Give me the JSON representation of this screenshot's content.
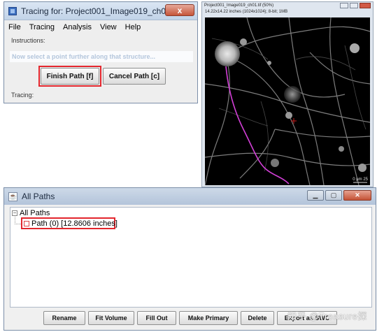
{
  "tracing_window": {
    "title": "Tracing for: Project001_Image019_ch01",
    "close_glyph": "x",
    "menu": [
      "File",
      "Tracing",
      "Analysis",
      "View",
      "Help"
    ],
    "instructions_label": "Instructions:",
    "instruction_text": "Now select a point further along that structure...",
    "finish_button": "Finish Path [f]",
    "cancel_button": "Cancel Path [c]",
    "tracing_label": "Tracing:"
  },
  "image_window": {
    "title": "Project001_Image019_ch01.tif (50%)",
    "info": "14.22x14.22 inches (1024x1024); 8-bit; 1MB",
    "scale_label": "0 μm 25",
    "path_color": "#d23fd6",
    "crosshair_color": "#e02020"
  },
  "all_paths_window": {
    "title": "All Paths",
    "root_label": "All Paths",
    "path_item": "Path (0) [12.8606 inches]",
    "buttons": [
      "Rename",
      "Fit Volume",
      "Fill Out",
      "Make Primary",
      "Delete",
      "Export as SWC"
    ],
    "watermark": "知乎 @Treasure探"
  },
  "highlight_color": "#e3262d"
}
